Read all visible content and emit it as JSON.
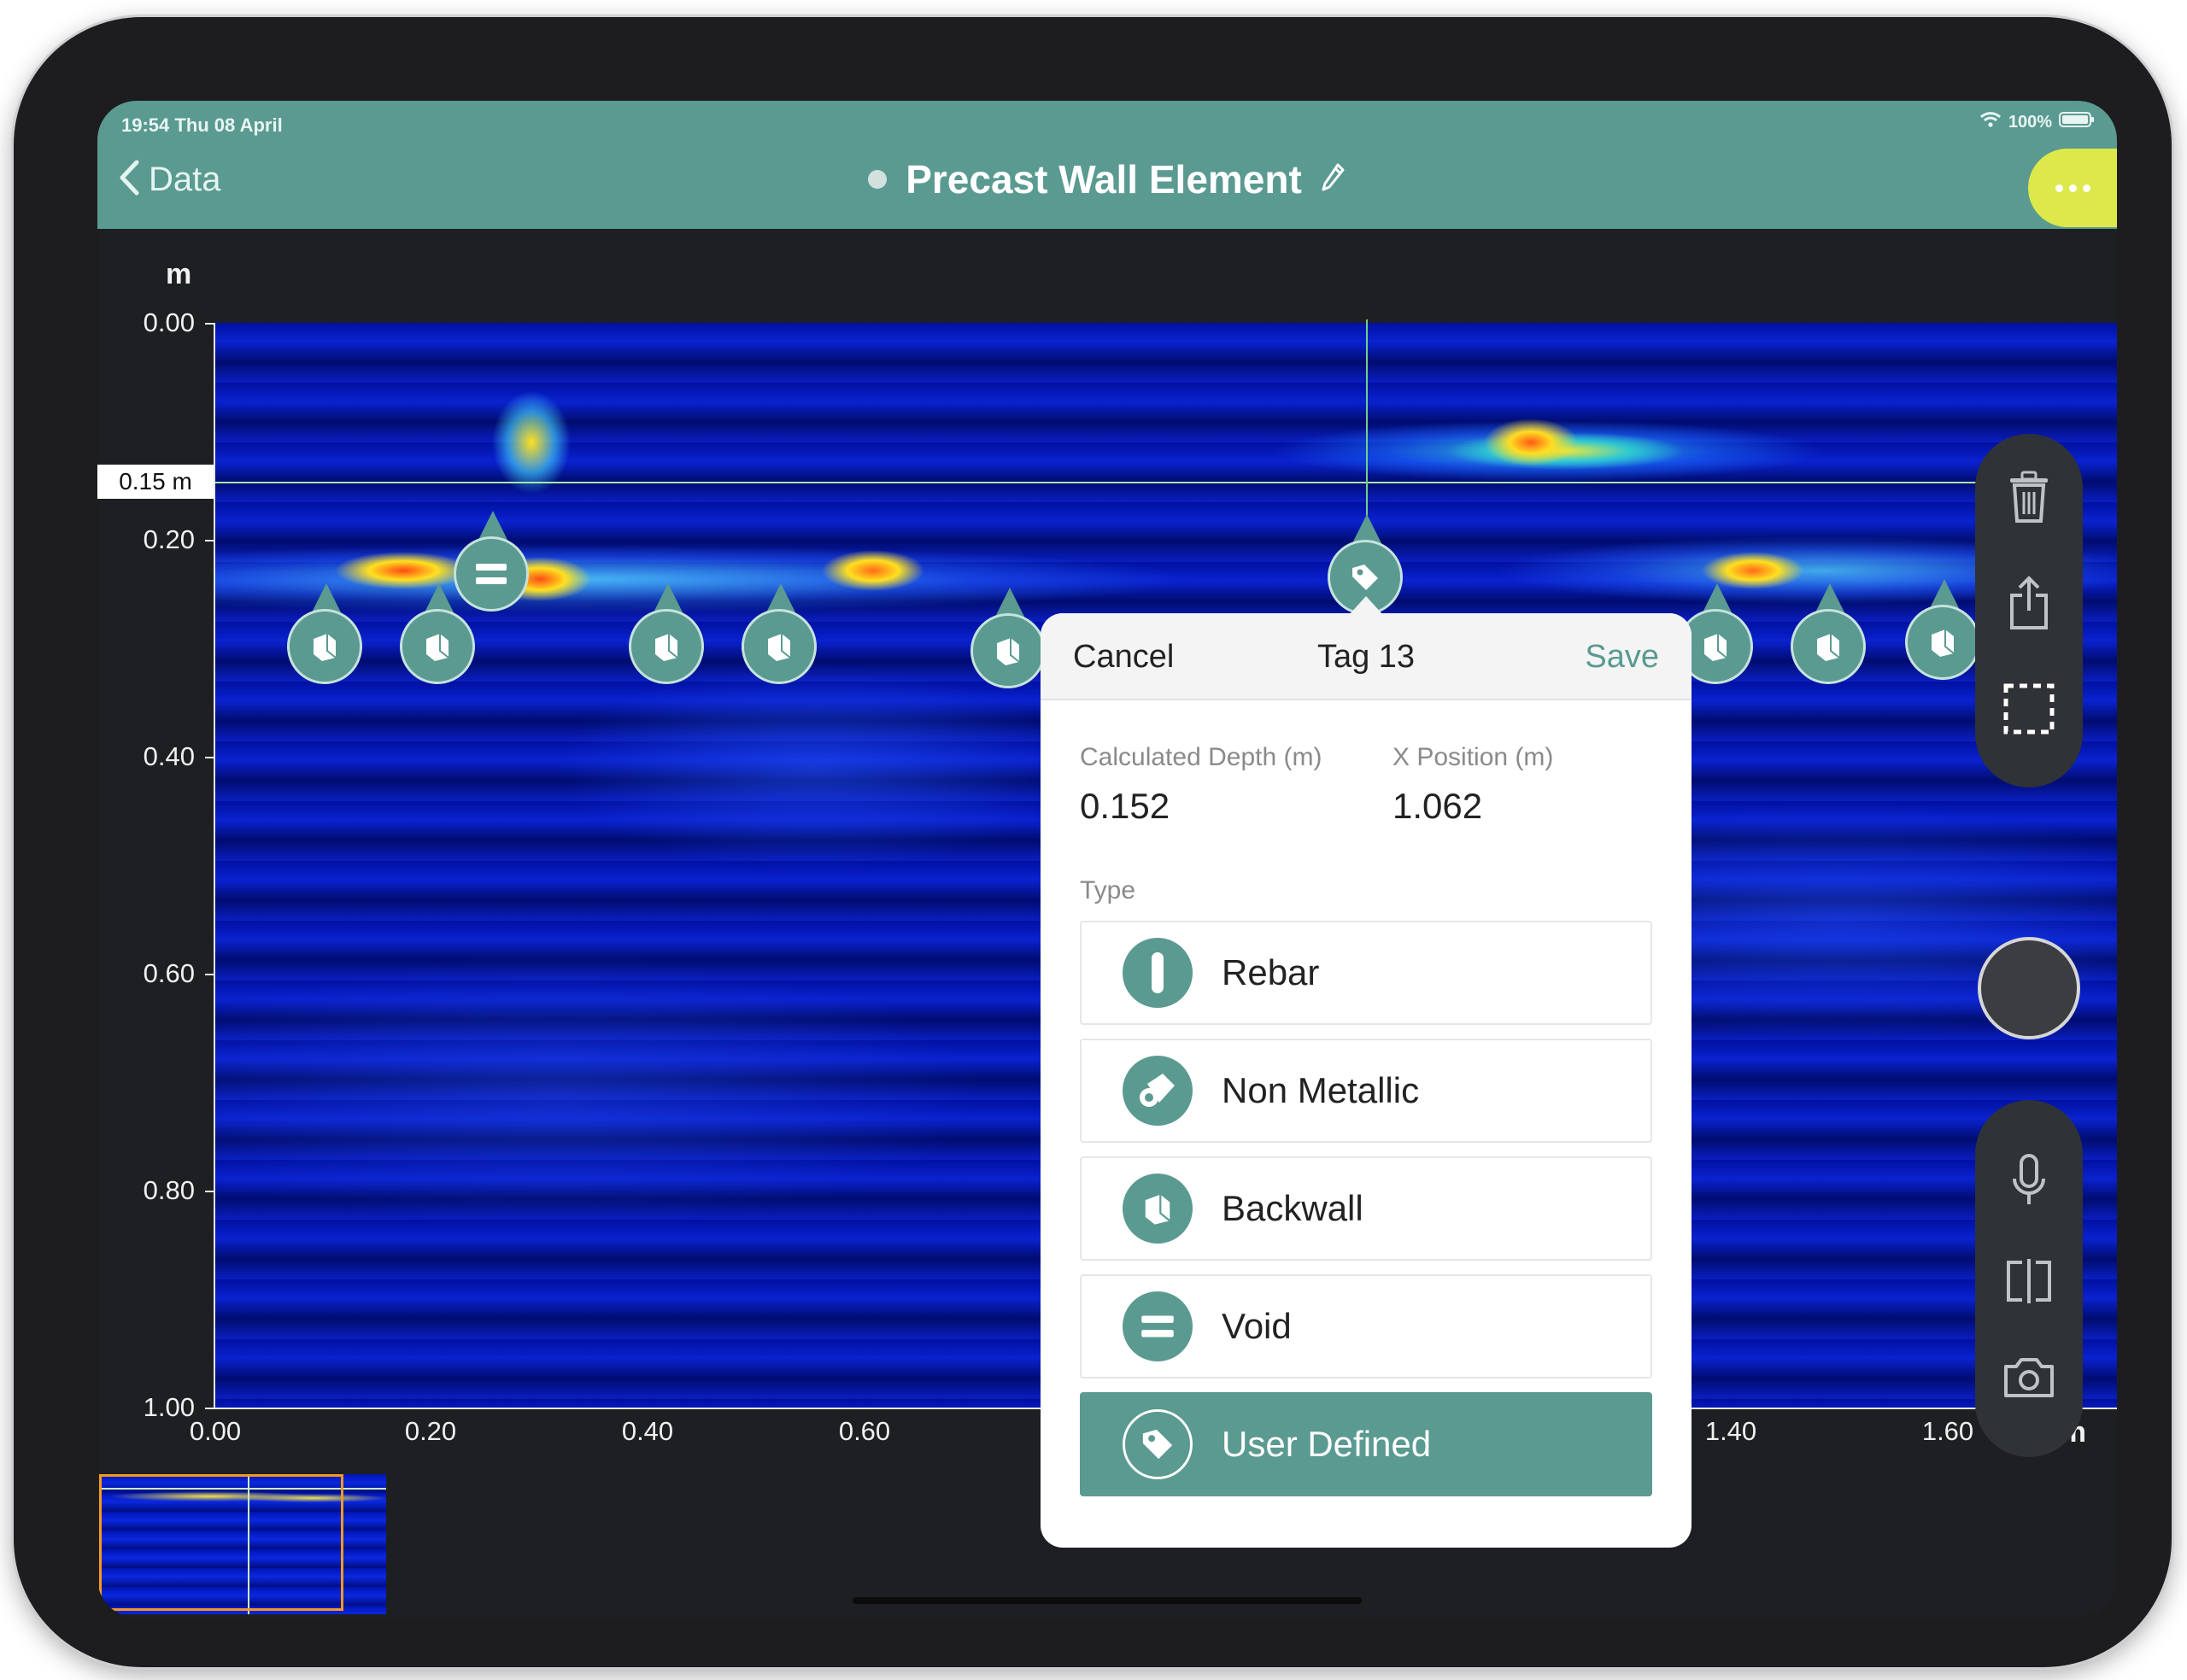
{
  "status_bar": {
    "time": "19:54 Thu 08 April",
    "battery": "100%"
  },
  "nav": {
    "back_label": "Data",
    "title": "Precast Wall Element",
    "more_icon": "ellipsis-icon"
  },
  "plot": {
    "y_unit": "m",
    "x_unit": "m",
    "y_ticks": [
      "0.00",
      "0.20",
      "0.40",
      "0.60",
      "0.80",
      "1.00"
    ],
    "x_ticks": [
      "0.00",
      "0.20",
      "0.40",
      "0.60",
      "1.40",
      "1.60"
    ],
    "cursor_depth_label": "0.15 m"
  },
  "tags": [
    {
      "type": "void",
      "icon": "void-icon"
    },
    {
      "type": "backwall",
      "icon": "backwall-icon"
    },
    {
      "type": "backwall",
      "icon": "backwall-icon"
    },
    {
      "type": "backwall",
      "icon": "backwall-icon"
    },
    {
      "type": "backwall",
      "icon": "backwall-icon"
    },
    {
      "type": "backwall",
      "icon": "backwall-icon"
    },
    {
      "type": "user-defined",
      "icon": "tag-icon"
    },
    {
      "type": "backwall",
      "icon": "backwall-icon"
    },
    {
      "type": "backwall",
      "icon": "backwall-icon"
    },
    {
      "type": "backwall",
      "icon": "backwall-icon"
    }
  ],
  "toolbar_top": [
    "trash-icon",
    "share-icon",
    "select-area-icon"
  ],
  "toolbar_bottom": [
    "microphone-icon",
    "split-view-icon",
    "camera-icon"
  ],
  "popover": {
    "cancel": "Cancel",
    "title": "Tag 13",
    "save": "Save",
    "depth_label": "Calculated Depth (m)",
    "depth_value": "0.152",
    "x_label": "X Position (m)",
    "x_value": "1.062",
    "type_label": "Type",
    "types": [
      {
        "label": "Rebar",
        "icon": "rebar-icon",
        "selected": false
      },
      {
        "label": "Non Metallic",
        "icon": "non-metallic-icon",
        "selected": false
      },
      {
        "label": "Backwall",
        "icon": "backwall-icon",
        "selected": false
      },
      {
        "label": "Void",
        "icon": "void-icon",
        "selected": false
      },
      {
        "label": "User Defined",
        "icon": "tag-icon",
        "selected": true
      }
    ]
  },
  "colors": {
    "accent": "#5a9a91",
    "more_button": "#dde84a",
    "minimap_frame": "#f39a1e"
  }
}
